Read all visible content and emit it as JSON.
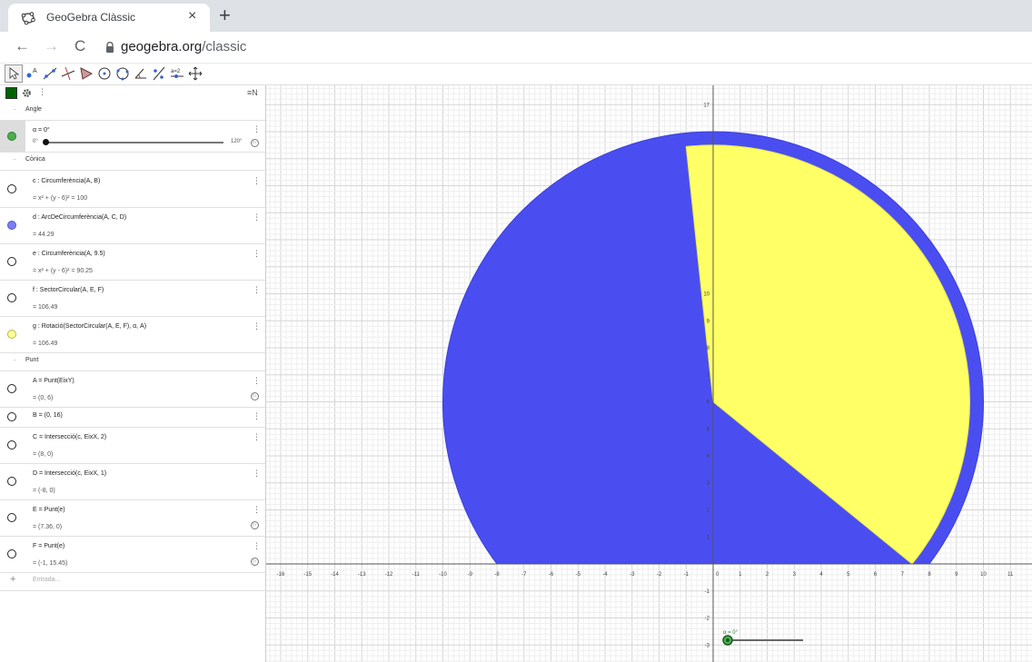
{
  "browser": {
    "tab_title": "GeoGebra Clàssic",
    "close_glyph": "×",
    "new_tab_glyph": "+",
    "back_glyph": "←",
    "forward_glyph": "→",
    "reload_glyph": "C",
    "url_domain": "geogebra.org",
    "url_path": "/classic"
  },
  "toolbar": {
    "tools": [
      "move-tool-icon",
      "point-tool-icon",
      "line-tool-icon",
      "perpendicular-tool-icon",
      "polygon-tool-icon",
      "circle-tool-icon",
      "circle-three-points-icon",
      "angle-tool-icon",
      "reflect-tool-icon",
      "slider-tool-icon",
      "move-graphics-icon"
    ]
  },
  "algebra": {
    "more_glyph": "⋮",
    "sort_glyph": "≡N",
    "play_glyph": "▷",
    "input_plus": "+",
    "input_placeholder": "Entrada...",
    "sections": [
      {
        "id": "angle",
        "label": "Angle"
      },
      {
        "id": "conica",
        "label": "Cònica"
      },
      {
        "id": "punt",
        "label": "Punt"
      }
    ],
    "slider": {
      "label": "α = 0°",
      "min_label": "0°",
      "max_label": "120°",
      "value_fraction": 0
    },
    "conics": [
      {
        "def": "c : Circumferència(A, B)",
        "val": "=  x² + (y - 6)² = 100",
        "marker": "empty"
      },
      {
        "def": "d : ArcDeCircumferència(A, C, D)",
        "val": "=  44.29",
        "marker": "blue"
      },
      {
        "def": "e : Circumferència(A, 9.5)",
        "val": "=  x² + (y - 6)² = 90.25",
        "marker": "empty"
      },
      {
        "def": "f : SectorCircular(A, E, F)",
        "val": "=  106.49",
        "marker": "empty"
      },
      {
        "def": "g : Rotació(SectorCircular(A, E, F), α, A)",
        "val": "=  106.49",
        "marker": "yellow"
      }
    ],
    "points": [
      {
        "def": "A  =  Punt(EixY)",
        "val": "=  (0, 6)",
        "play": true
      },
      {
        "def": "B = (0, 16)",
        "val": "",
        "play": false
      },
      {
        "def": "C  =  Intersecció(c, EixX, 2)",
        "val": "=  (8, 0)",
        "play": false
      },
      {
        "def": "D  =  Intersecció(c, EixX, 1)",
        "val": "=  (-8, 0)",
        "play": false
      },
      {
        "def": "E  =  Punt(e)",
        "val": "=  (7.36, 0)",
        "play": true
      },
      {
        "def": "F  =  Punt(e)",
        "val": "=  (-1, 15.45)",
        "play": true
      }
    ]
  },
  "graphics": {
    "x_ticks": [
      "-16",
      "-15",
      "-14",
      "-13",
      "-12",
      "-11",
      "-10",
      "-9",
      "-8",
      "-7",
      "-6",
      "-5",
      "-4",
      "-3",
      "-2",
      "-1",
      "0",
      "1",
      "2",
      "3",
      "4",
      "5",
      "6",
      "7",
      "8",
      "9",
      "10",
      "11"
    ],
    "y_ticks": [
      "-3",
      "-2",
      "-1",
      "1",
      "2",
      "3",
      "4",
      "5",
      "6",
      "7",
      "8",
      "9",
      "10",
      "17"
    ],
    "slider_label": "α = 0°",
    "colors": {
      "blue_region": "#4a4ef0",
      "yellow_sector": "#ffff66",
      "axis": "#555555",
      "grid_major": "#d6d6d6",
      "grid_minor": "#eeeeee"
    },
    "shapes": {
      "center": [
        0,
        6
      ],
      "outer_radius": 10,
      "sector_radius": 9.5,
      "sector_start_point": [
        7.36,
        0
      ],
      "sector_end_point": [
        -1,
        15.45
      ]
    }
  }
}
